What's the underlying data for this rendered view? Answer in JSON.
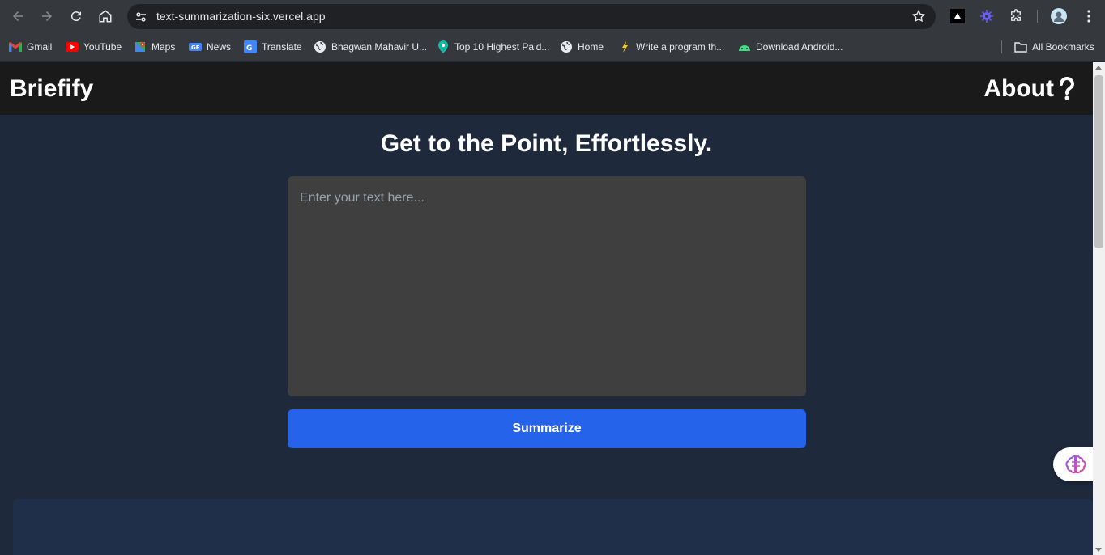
{
  "browser": {
    "url": "text-summarization-six.vercel.app",
    "bookmarks": [
      {
        "label": "Gmail",
        "icon": "gmail-icon"
      },
      {
        "label": "YouTube",
        "icon": "youtube-icon"
      },
      {
        "label": "Maps",
        "icon": "maps-icon"
      },
      {
        "label": "News",
        "icon": "news-icon"
      },
      {
        "label": "Translate",
        "icon": "translate-icon"
      },
      {
        "label": "Bhagwan Mahavir U...",
        "icon": "globe-icon"
      },
      {
        "label": "Top 10 Highest Paid...",
        "icon": "location-pin-icon"
      },
      {
        "label": "Home",
        "icon": "globe-icon"
      },
      {
        "label": "Write a program th...",
        "icon": "pen-icon"
      },
      {
        "label": "Download Android...",
        "icon": "android-icon"
      }
    ],
    "all_bookmarks": "All Bookmarks"
  },
  "header": {
    "brand": "Briefify",
    "about": "About",
    "about_icon": "question-icon"
  },
  "main": {
    "headline": "Get to the Point, Effortlessly.",
    "input_placeholder": "Enter your text here...",
    "input_value": "",
    "submit_label": "Summarize"
  },
  "colors": {
    "page_bg": "#1e293b",
    "header_bg": "#1a1a1b",
    "textarea_bg": "#3f3f3f",
    "button_bg": "#2563eb"
  }
}
